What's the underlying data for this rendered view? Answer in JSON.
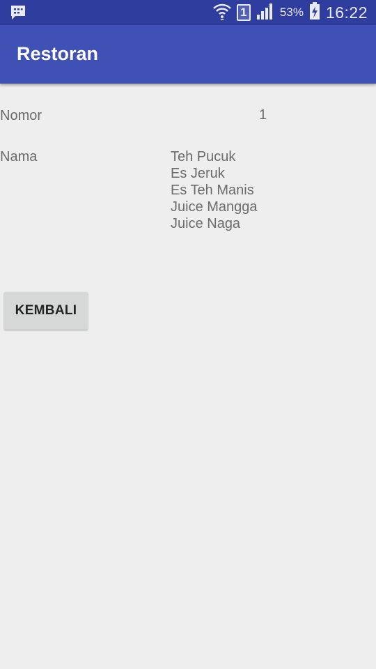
{
  "status_bar": {
    "notification_icon": "bbm-chat-icon",
    "wifi_icon": "wifi-icon",
    "sim_label": "1",
    "signal_icon": "signal-icon",
    "battery_percent": "53%",
    "battery_icon": "battery-charging-icon",
    "time": "16:22"
  },
  "app_bar": {
    "title": "Restoran",
    "color": "#3f51b5"
  },
  "detail": {
    "nomor_label": "Nomor",
    "nomor_value": "1",
    "nama_label": "Nama",
    "nama_items": [
      "Teh Pucuk",
      "Es Jeruk",
      "Es Teh Manis",
      "Juice Mangga",
      "Juice Naga"
    ]
  },
  "actions": {
    "back_label": "KEMBALI"
  }
}
